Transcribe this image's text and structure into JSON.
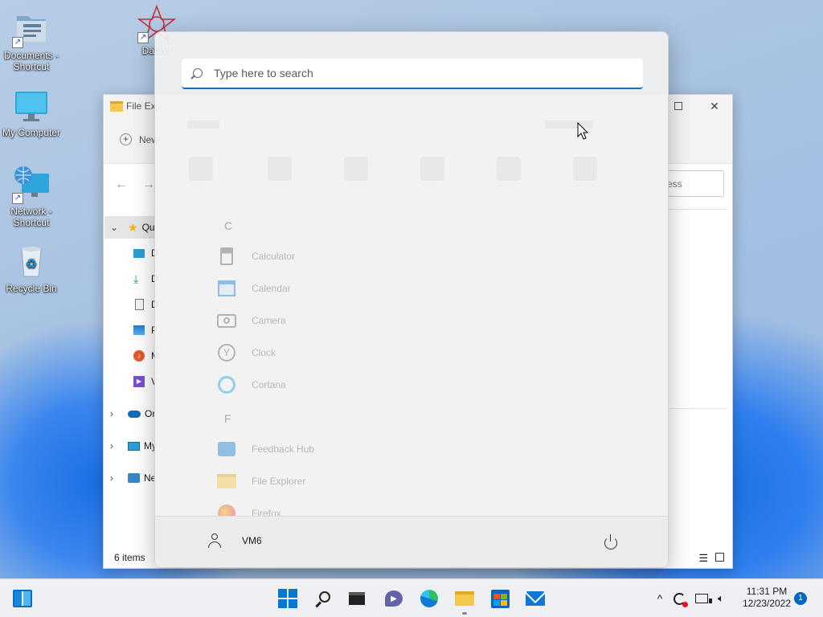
{
  "desktop": {
    "icons": [
      {
        "label": "Documents - Shortcut"
      },
      {
        "label": "DataW"
      },
      {
        "label": "My Computer"
      },
      {
        "label": "Network - Shortcut"
      },
      {
        "label": "Recycle Bin"
      }
    ]
  },
  "file_explorer": {
    "title": "File Exp",
    "new_label": "New",
    "address_fragment": "ess",
    "sidebar": [
      {
        "label": "Qu",
        "icon": "star-icon"
      },
      {
        "label": "D",
        "icon": "desktop-icon"
      },
      {
        "label": "D",
        "icon": "download-icon"
      },
      {
        "label": "D",
        "icon": "document-icon"
      },
      {
        "label": "P",
        "icon": "picture-icon"
      },
      {
        "label": "M",
        "icon": "music-icon"
      },
      {
        "label": "V",
        "icon": "video-icon"
      },
      {
        "label": "Or",
        "icon": "onedrive-icon"
      },
      {
        "label": "My",
        "icon": "computer-icon"
      },
      {
        "label": "Ne",
        "icon": "network-icon"
      }
    ],
    "status": "6 items"
  },
  "start_menu": {
    "search_placeholder": "Type here to search",
    "sections": [
      {
        "letter": "C",
        "apps": [
          "Calculator",
          "Calendar",
          "Camera",
          "Clock",
          "Cortana"
        ]
      },
      {
        "letter": "F",
        "apps": [
          "Feedback Hub",
          "File Explorer",
          "Firefox"
        ]
      }
    ],
    "user_name": "VM6"
  },
  "taskbar": {
    "time": "11:31 PM",
    "date": "12/23/2022",
    "notification_count": "1",
    "accent": "#0067c0"
  }
}
